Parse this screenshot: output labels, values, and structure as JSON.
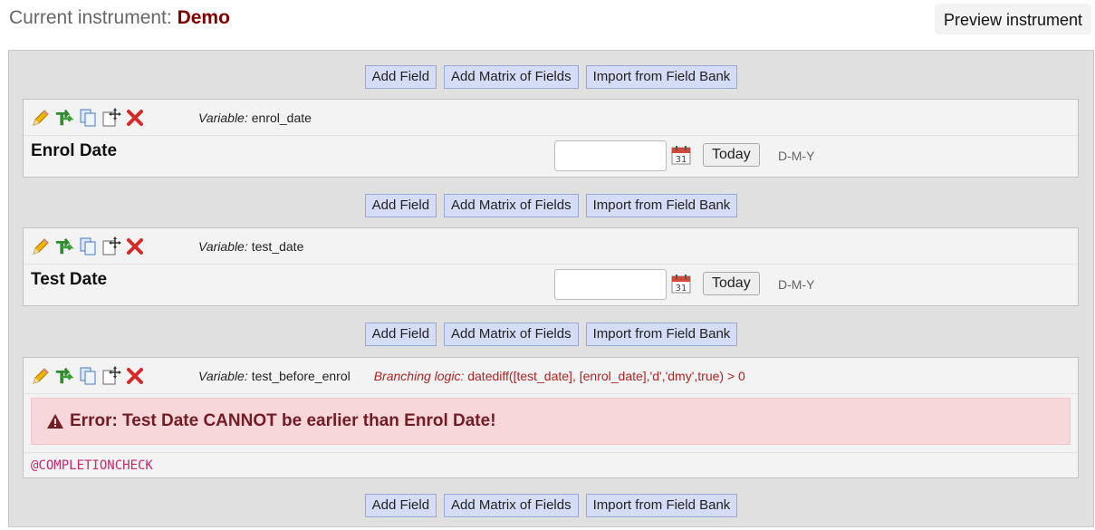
{
  "header": {
    "current_instrument_label": "Current instrument:",
    "instrument_name": "Demo",
    "preview_button": "Preview instrument"
  },
  "add_buttons": {
    "add_field": "Add Field",
    "add_matrix": "Add Matrix of Fields",
    "import_bank": "Import from Field Bank"
  },
  "icons": [
    "pencil-icon",
    "branching-icon",
    "copy-icon",
    "move-icon",
    "delete-icon",
    "calendar-icon",
    "warning-icon"
  ],
  "colors": {
    "instrument_name": "#800000",
    "add_button_bg": "#d5dcf5",
    "error_bg": "#f8d7da",
    "error_text": "#721c24",
    "branching_text": "#b22222",
    "action_tag": "#c8286e"
  },
  "fields": [
    {
      "variable_label": "Variable:",
      "variable_name": "enrol_date",
      "label": "Enrol Date",
      "today_button": "Today",
      "date_format": "D-M-Y",
      "value": ""
    },
    {
      "variable_label": "Variable:",
      "variable_name": "test_date",
      "label": "Test Date",
      "today_button": "Today",
      "date_format": "D-M-Y",
      "value": ""
    },
    {
      "variable_label": "Variable:",
      "variable_name": "test_before_enrol",
      "branching_label": "Branching logic:",
      "branching_logic": "datediff([test_date], [enrol_date],'d','dmy',true) > 0",
      "error_text": "Error: Test Date CANNOT be earlier than Enrol Date!",
      "action_tag": "@COMPLETIONCHECK"
    }
  ]
}
